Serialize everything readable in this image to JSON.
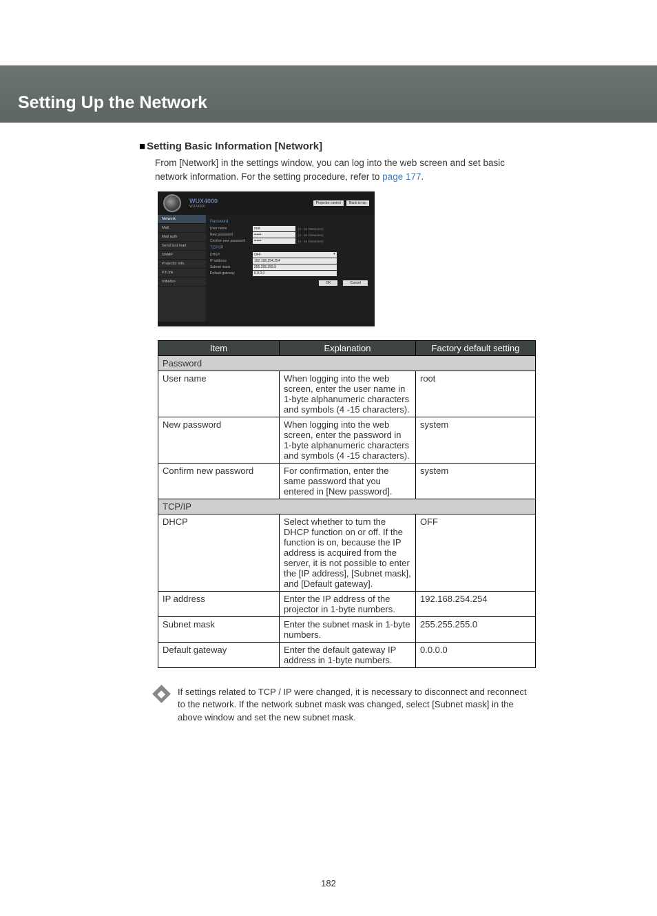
{
  "banner_title": "Setting Up the Network",
  "section_heading": "Setting Basic Information [Network]",
  "intro_text_1": "From [Network] in the settings window, you can log into the web screen and set basic network information. For the setting procedure, refer to ",
  "intro_link": "page 177",
  "intro_text_2": ".",
  "screenshot": {
    "model_title": "WUX4000",
    "model_sub": "WUX4000",
    "btn_projector_control": "Projector control",
    "btn_back_to_top": "Back to top",
    "side_items": [
      "Network",
      "Mail",
      "Mail auth",
      "Send test mail",
      "SNMP",
      "Projector info.",
      "PJLink",
      "Initialize"
    ],
    "group_password": "Password",
    "rows_password": [
      {
        "label": "User name",
        "value": "root",
        "hint": "(4 - 15 characters)"
      },
      {
        "label": "New password",
        "value": "••••••",
        "hint": "(4 - 15 characters)"
      },
      {
        "label": "Confirm new password",
        "value": "••••••",
        "hint": "(4 - 15 characters)"
      }
    ],
    "group_tcpip": "TCP/IP",
    "row_dhcp": {
      "label": "DHCP",
      "value": "OFF"
    },
    "rows_tcpip": [
      {
        "label": "IP address",
        "value": "192.168.254.254"
      },
      {
        "label": "Subnet mask",
        "value": "255.255.255.0"
      },
      {
        "label": "Default gateway",
        "value": "0.0.0.0"
      }
    ],
    "btn_ok": "OK",
    "btn_cancel": "Cancel"
  },
  "table": {
    "headers": [
      "Item",
      "Explanation",
      "Factory default setting"
    ],
    "group1": "Password",
    "rows1": [
      {
        "item": "User name",
        "expl": "When logging into the web screen, enter the user name in 1-byte alphanumeric characters and symbols (4 -15 characters).",
        "def": "root"
      },
      {
        "item": "New password",
        "expl": "When logging into the web screen, enter the password in 1-byte alphanumeric characters and symbols (4 -15 characters).",
        "def": "system"
      },
      {
        "item": "Confirm new password",
        "expl": "For confirmation, enter the same password that you entered in [New password].",
        "def": "system"
      }
    ],
    "group2": "TCP/IP",
    "rows2": [
      {
        "item": "DHCP",
        "expl": "Select whether to turn the DHCP function on or off. If the function is on, because the IP address is acquired from the server, it is not possible to enter the [IP address], [Subnet mask], and [Default gateway].",
        "def": "OFF"
      },
      {
        "item": "IP address",
        "expl": "Enter the IP address of the projector in 1-byte numbers.",
        "def": "192.168.254.254"
      },
      {
        "item": "Subnet mask",
        "expl": "Enter the subnet mask in 1-byte numbers.",
        "def": "255.255.255.0"
      },
      {
        "item": "Default gateway",
        "expl": "Enter the default gateway IP address in 1-byte numbers.",
        "def": "0.0.0.0"
      }
    ]
  },
  "note_text": "If settings related to TCP / IP were changed, it is necessary to disconnect and reconnect to the network. If the network subnet mask was changed, select [Subnet mask] in the above window and set the new subnet mask.",
  "page_number": "182"
}
